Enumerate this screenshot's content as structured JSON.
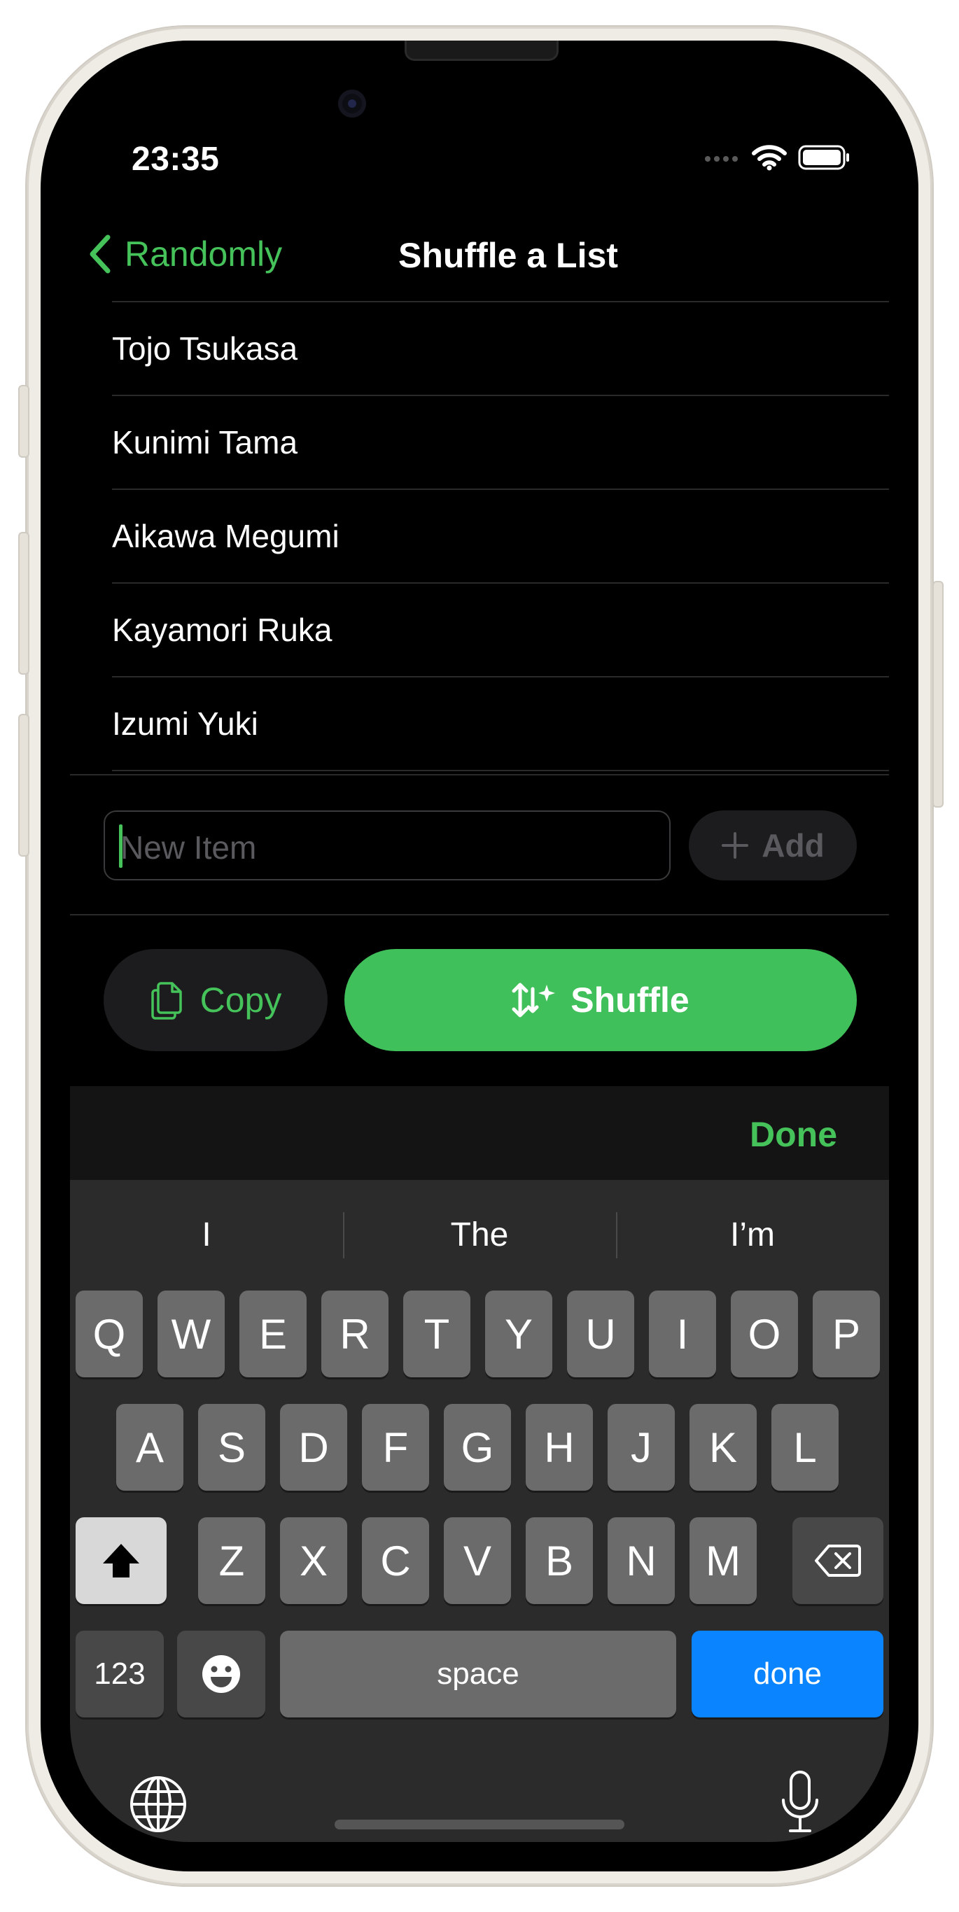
{
  "status": {
    "time": "23:35"
  },
  "nav": {
    "back_label": "Randomly",
    "title": "Shuffle a List"
  },
  "list": {
    "items": [
      "Tojo Tsukasa",
      "Kunimi Tama",
      "Aikawa Megumi",
      "Kayamori Ruka",
      "Izumi Yuki"
    ]
  },
  "input": {
    "placeholder": "New Item",
    "value": "",
    "add_label": "Add"
  },
  "actions": {
    "copy_label": "Copy",
    "shuffle_label": "Shuffle"
  },
  "keyboard_toolbar": {
    "done_label": "Done"
  },
  "keyboard": {
    "suggestions": [
      "I",
      "The",
      "I’m"
    ],
    "row1": [
      "Q",
      "W",
      "E",
      "R",
      "T",
      "Y",
      "U",
      "I",
      "O",
      "P"
    ],
    "row2": [
      "A",
      "S",
      "D",
      "F",
      "G",
      "H",
      "J",
      "K",
      "L"
    ],
    "row3": [
      "Z",
      "X",
      "C",
      "V",
      "B",
      "N",
      "M"
    ],
    "numbers_label": "123",
    "space_label": "space",
    "return_label": "done"
  },
  "colors": {
    "accent": "#45c25a",
    "return_key": "#0a84ff",
    "background": "#000000"
  }
}
